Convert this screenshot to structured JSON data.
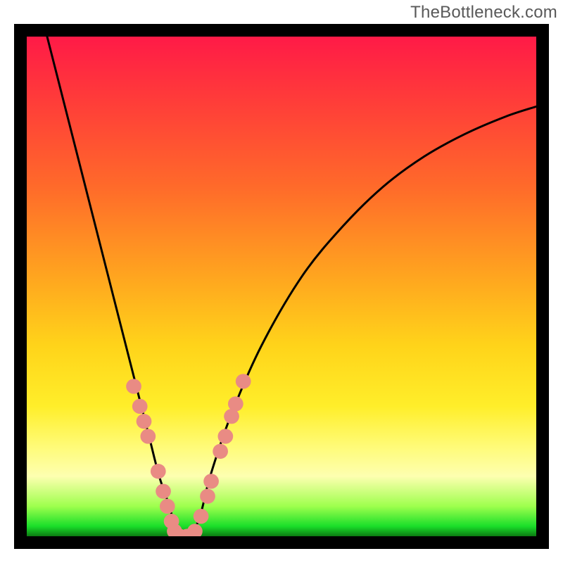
{
  "watermark": "TheBottleneck.com",
  "colors": {
    "marker": "#e98b84",
    "curve": "#000000",
    "frame": "#000000"
  },
  "chart_data": {
    "type": "line",
    "title": "",
    "xlabel": "",
    "ylabel": "",
    "xlim": [
      0,
      100
    ],
    "ylim": [
      0,
      100
    ],
    "grid": false,
    "series": [
      {
        "name": "bottleneck-curve",
        "x": [
          4,
          6,
          8,
          10,
          12,
          14,
          16,
          18,
          20,
          22,
          24,
          26,
          28,
          29,
          30,
          32,
          34,
          36,
          40,
          46,
          54,
          62,
          70,
          78,
          86,
          94,
          100
        ],
        "y": [
          100,
          92,
          84,
          76,
          68,
          60,
          52,
          44,
          36,
          28,
          20,
          12,
          6,
          2,
          0,
          0,
          4,
          12,
          24,
          38,
          52,
          62,
          70,
          76,
          80.5,
          84,
          86
        ]
      }
    ],
    "markers": {
      "name": "highlight-points",
      "points": [
        {
          "x": 21.0,
          "y": 30.0
        },
        {
          "x": 22.2,
          "y": 26.0
        },
        {
          "x": 23.0,
          "y": 23.0
        },
        {
          "x": 23.8,
          "y": 20.0
        },
        {
          "x": 25.8,
          "y": 13.0
        },
        {
          "x": 26.8,
          "y": 9.0
        },
        {
          "x": 27.6,
          "y": 6.0
        },
        {
          "x": 28.4,
          "y": 3.0
        },
        {
          "x": 29.0,
          "y": 1.0
        },
        {
          "x": 30.0,
          "y": 0.0
        },
        {
          "x": 31.5,
          "y": 0.0
        },
        {
          "x": 33.0,
          "y": 1.0
        },
        {
          "x": 34.2,
          "y": 4.0
        },
        {
          "x": 35.5,
          "y": 8.0
        },
        {
          "x": 36.2,
          "y": 11.0
        },
        {
          "x": 38.0,
          "y": 17.0
        },
        {
          "x": 39.0,
          "y": 20.0
        },
        {
          "x": 40.2,
          "y": 24.0
        },
        {
          "x": 41.0,
          "y": 26.5
        },
        {
          "x": 42.5,
          "y": 31.0
        }
      ]
    }
  }
}
